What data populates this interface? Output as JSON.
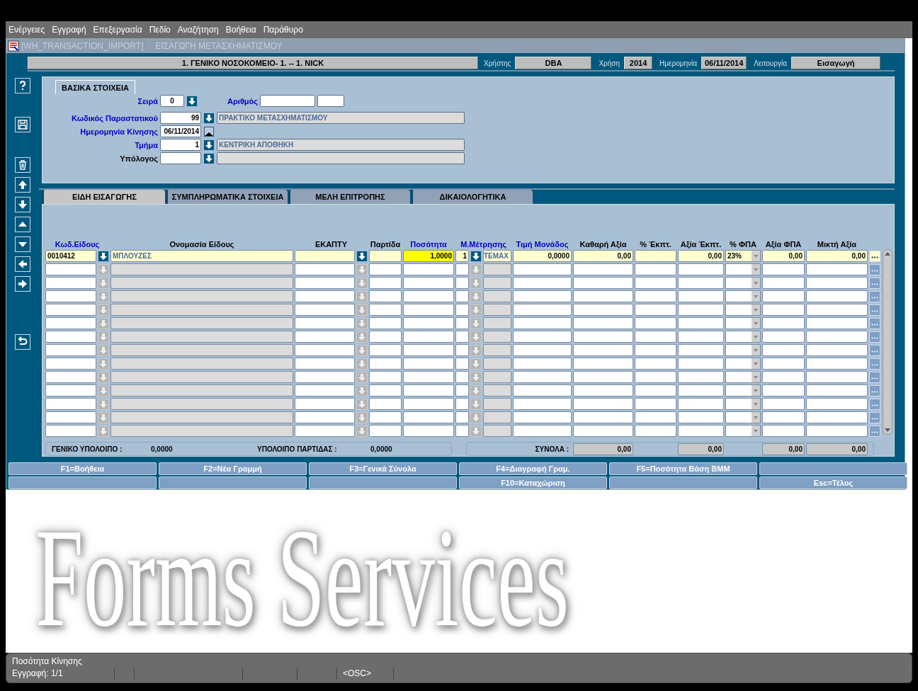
{
  "menu": [
    "Ενέργειες",
    "Εγγραφή",
    "Επεξεργασία",
    "Πεδίο",
    "Αναζήτηση",
    "Βοήθεια",
    "Παράθυρο"
  ],
  "window": {
    "title": "[WH_TRANSACTION_IMPORT]  :  ΕΙΣΑΓΩΓΗ ΜΕΤΑΣΧΗΜΑΤΙΣΜΟΥ"
  },
  "header": {
    "organization": "1. ΓΕΝΙΚΟ ΝΟΣΟΚΟΜΕΙΟ- 1. -- 1. NICK",
    "fields": [
      {
        "label": "Χρήστης",
        "value": "DBA"
      },
      {
        "label": "Χρήση",
        "value": "2014"
      },
      {
        "label": "Ημερομηνία",
        "value": "06/11/2014"
      },
      {
        "label": "Λειτουργία",
        "value": "Εισαγωγή"
      }
    ]
  },
  "basic": {
    "title": "ΒΑΣΙΚΑ ΣΤΟΙΧΕΙΑ",
    "series": {
      "label": "Σειρά",
      "value": "0",
      "required": true
    },
    "number": {
      "label": "Αριθμός",
      "required": true
    },
    "rows": [
      {
        "kind": "lov",
        "label": "Κωδικός Παραστατικού",
        "required": true,
        "value": "99",
        "description": "ΠΡΑΚΤΙΚΟ ΜΕΤΑΣΧΗΜΑΤΙΣΜΟΥ"
      },
      {
        "kind": "date",
        "label": "Ημερομηνία Κίνησης",
        "required": true,
        "value": "06/11/2014"
      },
      {
        "kind": "lov",
        "label": "Τμήμα",
        "required": true,
        "value": "1",
        "description": "ΚΕΝΤΡΙΚΗ ΑΠΟΘΗΚΗ"
      },
      {
        "kind": "lov",
        "label": "Υπόλογος",
        "required": false
      }
    ]
  },
  "tabs": [
    {
      "label": "ΕΙΔΗ ΕΙΣΑΓΩΓΗΣ",
      "selected": true
    },
    {
      "label": "ΣΥΜΠΛΗΡΩΜΑΤΙΚΑ ΣΤΟΙΧΕΙΑ",
      "selected": false
    },
    {
      "label": "ΜΕΛΗ ΕΠΙΤΡΟΠΗΣ",
      "selected": false
    },
    {
      "label": "ΔΙΚΑΙΟΛΟΓΗΤΙΚΑ",
      "selected": false
    }
  ],
  "table": {
    "columns": [
      {
        "label": "Κωδ.Είδους",
        "required": true
      },
      {
        "label": "Ονομασία Είδους",
        "required": false
      },
      {
        "label": "ΕΚΑΠΤΥ",
        "required": false
      },
      {
        "label": "Παρτίδα",
        "required": false
      },
      {
        "label": "Ποσότητα",
        "required": true
      },
      {
        "label": "Μ.Μέτρησης",
        "required": true
      },
      {
        "label": "Τιμή Μονάδος",
        "required": true
      },
      {
        "label": "Καθαρή Αξία",
        "required": false
      },
      {
        "label": "% Έκπτ.",
        "required": false
      },
      {
        "label": "Αξία Έκπτ.",
        "required": false
      },
      {
        "label": "% ΦΠΑ",
        "required": false
      },
      {
        "label": "Αξία  ΦΠΑ",
        "required": false
      },
      {
        "label": "Μικτή Αξία",
        "required": false
      }
    ],
    "rows": [
      {
        "kind": "record",
        "code": "0010412",
        "name": "ΜΠΛΟΥΖΕΣ",
        "quantity": "1,0000",
        "quantity_focused": true,
        "unit_code": "1",
        "unit": "ΤΕΜΑΧ",
        "unit_price": "0,0000",
        "net_value": "0,00",
        "discount_value": "0,00",
        "vat_percent": "23%",
        "vat_value": "0,00",
        "gross_value": "0,00"
      },
      {
        "kind": "blank"
      },
      {
        "kind": "blank"
      },
      {
        "kind": "blank"
      },
      {
        "kind": "blank"
      },
      {
        "kind": "blank"
      },
      {
        "kind": "blank"
      },
      {
        "kind": "blank"
      },
      {
        "kind": "blank"
      },
      {
        "kind": "blank"
      },
      {
        "kind": "blank"
      },
      {
        "kind": "blank"
      },
      {
        "kind": "blank"
      },
      {
        "kind": "blank"
      }
    ],
    "balance": {
      "general_label": "ΓΕΝΙΚΟ ΥΠΟΛΟΙΠΟ :",
      "general_value": "0,0000",
      "batch_label": "ΥΠΟΛΟΙΠΟ ΠΑΡΤΙΔΑΣ :",
      "batch_value": "0,0000"
    },
    "totals": {
      "label": "ΣΥΝΟΛΑ :",
      "net_value": "0,00",
      "discount_value": "0,00",
      "vat_value": "0,00",
      "gross_value": "0,00"
    }
  },
  "function_keys": [
    {
      "kind": "key",
      "label": "F1=Βοήθεια"
    },
    {
      "kind": "key",
      "label": "F2=Νέα Γραμμή"
    },
    {
      "kind": "key",
      "label": "F3=Γενικά Σύνολα"
    },
    {
      "kind": "key",
      "label": "F4=Διαγραφή Γραμ."
    },
    {
      "kind": "key",
      "label": "F5=Ποσότητα Βάση ΒΜΜ"
    },
    {
      "kind": "blank"
    },
    {
      "kind": "blank"
    },
    {
      "kind": "blank"
    },
    {
      "kind": "blank"
    },
    {
      "kind": "key",
      "label": "F10=Καταχώριση"
    },
    {
      "kind": "blank"
    },
    {
      "kind": "key",
      "label": "Esc=Τέλος"
    }
  ],
  "background_logo": "Forms Services",
  "status_bar": {
    "hint": "Ποσότητα Κίνησης",
    "record": "Εγγραφή: 1/1",
    "mode": "<OSC>"
  }
}
